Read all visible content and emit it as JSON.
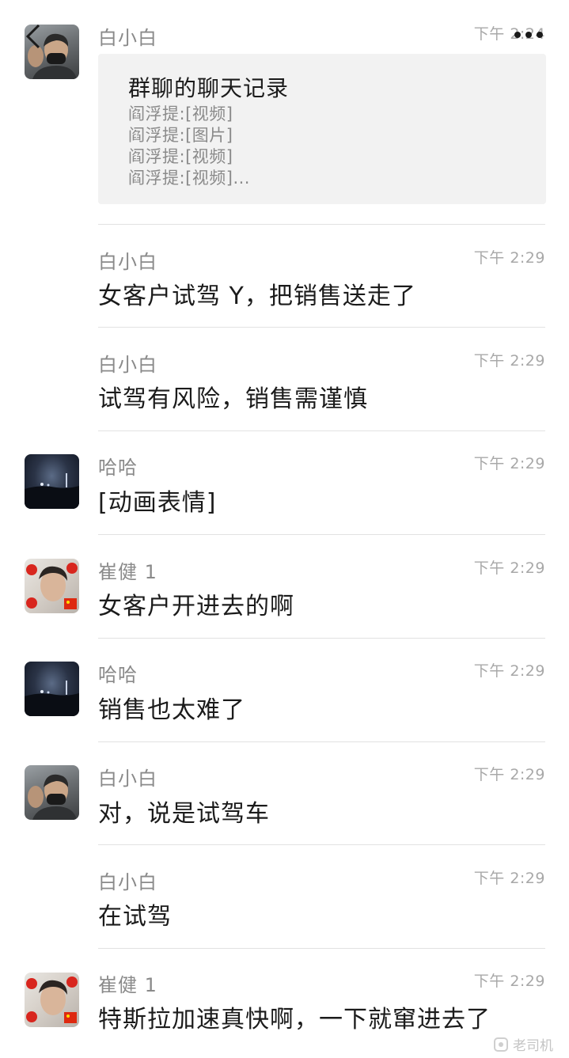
{
  "header": {
    "back_icon": "chevron-left-icon",
    "more_icon": "more-dots-icon"
  },
  "card": {
    "title": "群聊的聊天记录",
    "lines": [
      "阎浮提:[视频]",
      "阎浮提:[图片]",
      "阎浮提:[视频]",
      "阎浮提:[视频]..."
    ]
  },
  "messages": [
    {
      "sender": "白小白",
      "time": "下午 2:24",
      "text": ""
    },
    {
      "sender": "白小白",
      "time": "下午 2:29",
      "text": "女客户试驾 Y，把销售送走了"
    },
    {
      "sender": "白小白",
      "time": "下午 2:29",
      "text": "试驾有风险，销售需谨慎"
    },
    {
      "sender": "哈哈",
      "time": "下午 2:29",
      "text": "[动画表情]"
    },
    {
      "sender": "崔健 1",
      "time": "下午 2:29",
      "text": "女客户开进去的啊"
    },
    {
      "sender": "哈哈",
      "time": "下午 2:29",
      "text": "销售也太难了"
    },
    {
      "sender": "白小白",
      "time": "下午 2:29",
      "text": "对，说是试驾车"
    },
    {
      "sender": "白小白",
      "time": "下午 2:29",
      "text": "在试驾"
    },
    {
      "sender": "崔健 1",
      "time": "下午 2:29",
      "text": "特斯拉加速真快啊，一下就窜进去了"
    }
  ],
  "watermark": {
    "label": "老司机"
  }
}
